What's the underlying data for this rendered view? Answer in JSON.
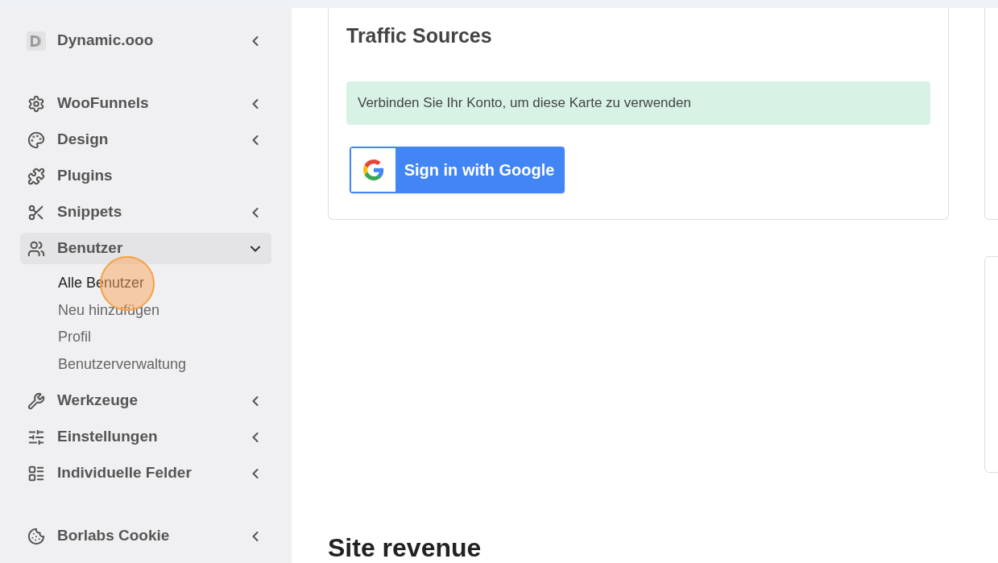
{
  "sidebar": {
    "sections": [
      {
        "items": [
          {
            "label": "Dynamic.ooo",
            "kind": "group",
            "expanded": false
          }
        ]
      },
      {
        "items": [
          {
            "label": "WooFunnels",
            "kind": "group",
            "expanded": false
          },
          {
            "label": "Design",
            "kind": "group",
            "expanded": false
          },
          {
            "label": "Plugins",
            "kind": "link"
          },
          {
            "label": "Snippets",
            "kind": "group",
            "expanded": false
          },
          {
            "label": "Benutzer",
            "kind": "group",
            "expanded": true,
            "children": [
              {
                "label": "Alle Benutzer",
                "selected": true
              },
              {
                "label": "Neu hinzufügen",
                "selected": false
              },
              {
                "label": "Profil",
                "selected": false
              },
              {
                "label": "Benutzerverwaltung",
                "selected": false
              }
            ]
          },
          {
            "label": "Werkzeuge",
            "kind": "group",
            "expanded": false
          },
          {
            "label": "Einstellungen",
            "kind": "group",
            "expanded": false
          },
          {
            "label": "Individuelle Felder",
            "kind": "group",
            "expanded": false
          }
        ]
      },
      {
        "items": [
          {
            "label": "Borlabs Cookie",
            "kind": "group",
            "expanded": false
          }
        ]
      }
    ]
  },
  "traffic_card": {
    "title": "Traffic Sources",
    "notice": "Verbinden Sie Ihr Konto, um diese Karte zu verwenden",
    "button": "Sign in with Google"
  },
  "section_heading": "Site revenue"
}
